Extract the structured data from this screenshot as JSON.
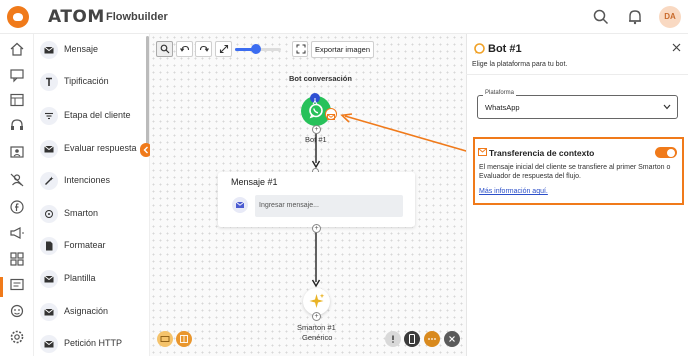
{
  "app": {
    "brand": "ATOM",
    "product": "Flowbuilder",
    "user_initials": "DA"
  },
  "colors": {
    "accent": "#f07a1a",
    "whatsapp": "#27c15a",
    "link": "#2b4fc9",
    "primary": "#3b6cf0"
  },
  "topbar": {
    "icons": [
      "search-icon",
      "bell-icon"
    ]
  },
  "rail": {
    "icons": [
      "home-icon",
      "chat-icon",
      "table-icon",
      "headset-icon",
      "contact-card-icon",
      "mute-user-icon",
      "facebook-icon",
      "megaphone-icon",
      "flows-icon",
      "message-square-icon",
      "bot-icon",
      "settings-icon"
    ],
    "active": "flows-icon"
  },
  "palette": {
    "items": [
      {
        "label": "Mensaje",
        "icon": "mail-icon"
      },
      {
        "label": "Tipificación",
        "icon": "tag-icon"
      },
      {
        "label": "Etapa del cliente",
        "icon": "filter-icon"
      },
      {
        "label": "Evaluar respuesta",
        "icon": "mail-icon"
      },
      {
        "label": "Intenciones",
        "icon": "magic-wand-icon"
      },
      {
        "label": "Smarton",
        "icon": "smarton-icon"
      },
      {
        "label": "Formatear",
        "icon": "document-icon"
      },
      {
        "label": "Plantilla",
        "icon": "mail-icon"
      },
      {
        "label": "Asignación",
        "icon": "mail-icon"
      },
      {
        "label": "Petición HTTP",
        "icon": "mail-icon"
      }
    ]
  },
  "toolbar": {
    "export_label": "Exportar imagen",
    "zoom_level": 0.45
  },
  "canvas": {
    "start_caption": "Bot conversación",
    "bot_node_label": "Bot #1",
    "message_node": {
      "title": "Mensaje #1",
      "input_placeholder": "Ingresar mensaje..."
    },
    "smarton_node": {
      "line1": "Smarton #1",
      "line2": "Genérico"
    }
  },
  "panel": {
    "title": "Bot #1",
    "subtitle": "Elige la plataforma para tu bot.",
    "platform": {
      "legend": "Plataforma",
      "value": "WhatsApp"
    },
    "context": {
      "title": "Transferencia de contexto",
      "description": "El mensaje inicial del cliente se transfiere al primer Smarton o Evaluador de respuesta del flujo.",
      "link": "Más información aquí.",
      "enabled": true
    }
  }
}
